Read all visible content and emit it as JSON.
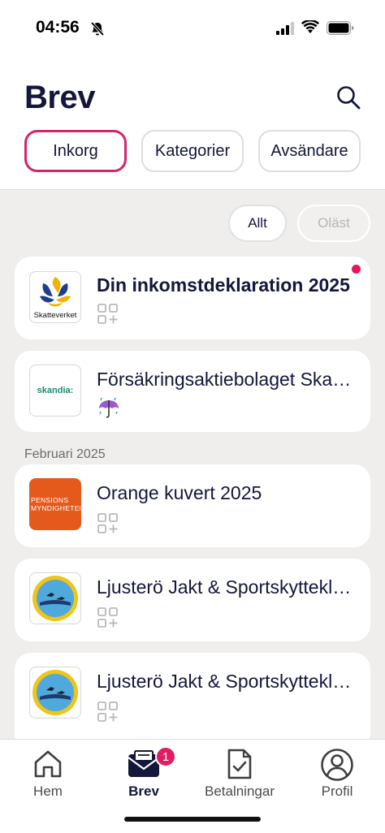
{
  "status_bar": {
    "time": "04:56"
  },
  "header": {
    "title": "Brev",
    "tabs": [
      {
        "label": "Inkorg",
        "active": true
      },
      {
        "label": "Kategorier",
        "active": false
      },
      {
        "label": "Avsändare",
        "active": false
      }
    ]
  },
  "filters": {
    "all_label": "Allt",
    "unread_label": "Oläst"
  },
  "section": {
    "label": "Februari 2025"
  },
  "messages": [
    {
      "title": "Din inkomstdeklaration 2025",
      "sender_logo_text": "Skatteverket",
      "unread": true,
      "icon": "add-category-icon"
    },
    {
      "title": "Försäkringsaktiebolaget Skandia",
      "sender_logo_text": "skandia:",
      "unread": false,
      "icon": "umbrella-rain-icon"
    },
    {
      "title": "Orange kuvert 2025",
      "sender_logo_text": "PENSIONS MYNDIGHETEN",
      "unread": false,
      "icon": "add-category-icon"
    },
    {
      "title": "Ljusterö Jakt & Sportskytteklubb",
      "sender_logo_text": "",
      "unread": false,
      "icon": "add-category-icon"
    },
    {
      "title": "Ljusterö Jakt & Sportskytteklubb",
      "sender_logo_text": "",
      "unread": false,
      "icon": "add-category-icon"
    }
  ],
  "tabbar": {
    "items": [
      {
        "label": "Hem",
        "icon": "home-icon"
      },
      {
        "label": "Brev",
        "icon": "mail-icon",
        "badge": "1"
      },
      {
        "label": "Betalningar",
        "icon": "invoice-check-icon"
      },
      {
        "label": "Profil",
        "icon": "profile-icon"
      }
    ]
  },
  "colors": {
    "accent": "#d6246a",
    "text": "#14163a",
    "background": "#efeeed"
  }
}
